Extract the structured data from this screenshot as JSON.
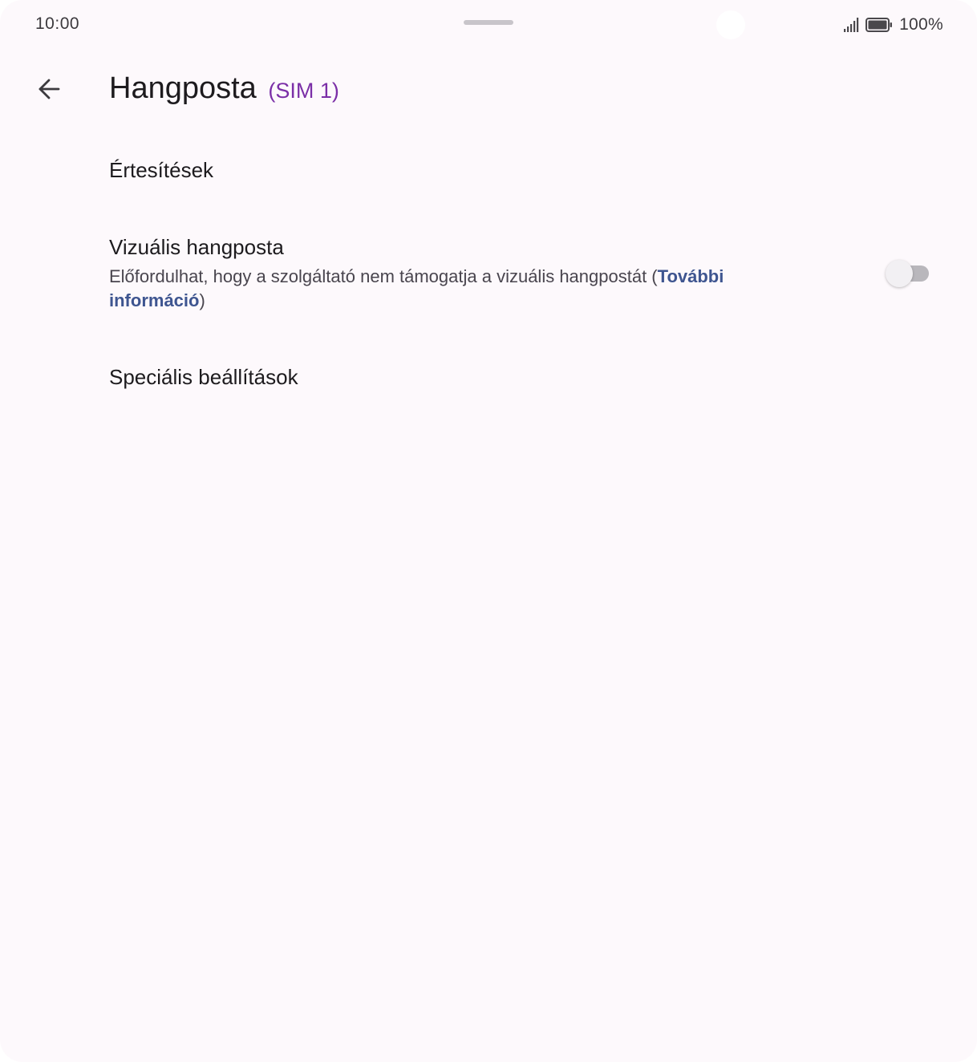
{
  "status_bar": {
    "time": "10:00",
    "battery_percent": "100%",
    "signal_icon": "cell-signal-icon",
    "battery_icon": "battery-full-icon"
  },
  "app_bar": {
    "back_icon": "arrow-back-icon",
    "title": "Hangposta",
    "sim": "(SIM 1)"
  },
  "settings": {
    "notifications": {
      "label": "Értesítések"
    },
    "visual_voicemail": {
      "label": "Vizuális hangposta",
      "summary_text": "Előfordulhat, hogy a szolgáltató nem támogatja a vizuális hangpostát (",
      "summary_link": "További információ",
      "summary_close": ")",
      "enabled": false
    },
    "advanced": {
      "label": "Speciális beállítások"
    }
  },
  "colors": {
    "background": "#fdf9fc",
    "accent_sim": "#7b2fa7",
    "link": "#3e5590",
    "toggle_off_track": "#b9b7bc"
  }
}
